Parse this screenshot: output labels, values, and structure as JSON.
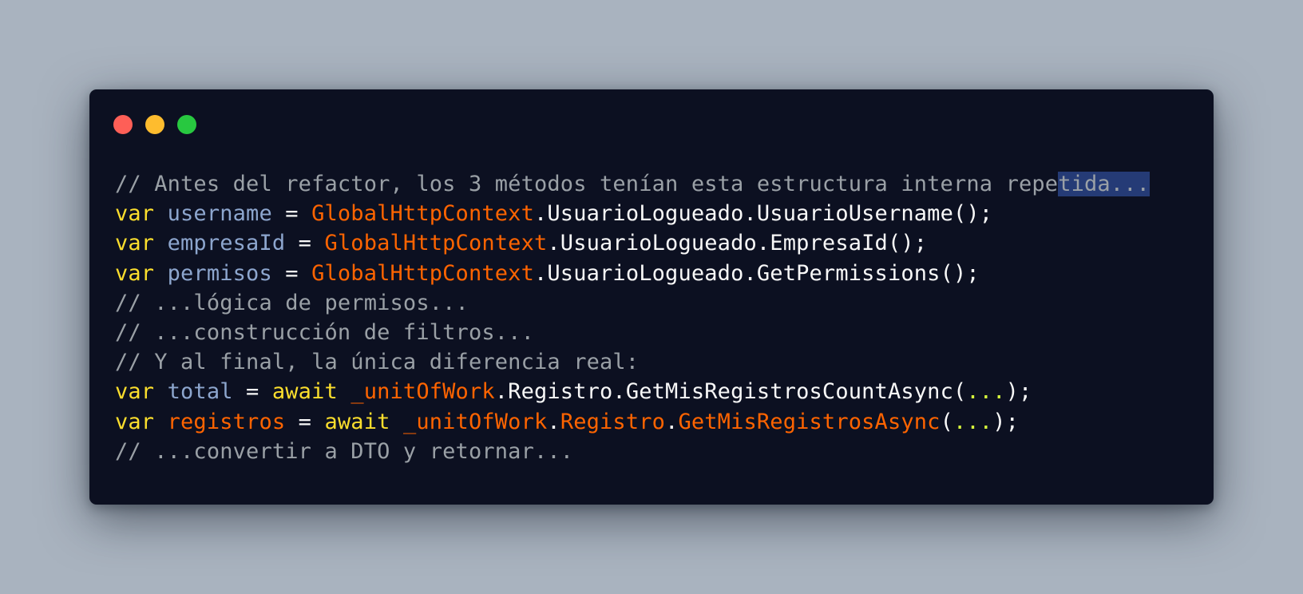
{
  "window": {
    "buttons": {
      "close": "close",
      "minimize": "minimize",
      "maximize": "maximize"
    },
    "colors": {
      "background": "#0c1021",
      "comment": "#9aa0a6",
      "keyword": "#fbde2d",
      "variable": "#8da6ce",
      "class": "#ff6400",
      "identifier": "#f8f8f8",
      "ellipsis": "#d8fa3c",
      "selection": "#253b76"
    }
  },
  "code": {
    "lines": [
      {
        "comment_before_selection": "// Antes del refactor, los 3 métodos tenían esta estructura interna repe",
        "comment_selected": "tida..."
      },
      {
        "kw": "var",
        "var": "username",
        "eq": " = ",
        "cls": "GlobalHttpContext",
        "rest": ".UsuarioLogueado.UsuarioUsername();"
      },
      {
        "kw": "var",
        "var": "empresaId",
        "eq": " = ",
        "cls": "GlobalHttpContext",
        "rest": ".UsuarioLogueado.EmpresaId();"
      },
      {
        "kw": "var",
        "var": "permisos",
        "eq": " = ",
        "cls": "GlobalHttpContext",
        "rest": ".UsuarioLogueado.GetPermissions();"
      },
      {
        "comment": "// ...lógica de permisos..."
      },
      {
        "comment": "// ...construcción de filtros..."
      },
      {
        "comment": "// Y al final, la única diferencia real:"
      },
      {
        "kw": "var",
        "var": "total",
        "eq": " = ",
        "kw2": "await",
        "cls": "_unitOfWork",
        "rest": ".Registro.GetMisRegistrosCountAsync(",
        "dots": "...",
        "end": ");"
      },
      {
        "kw": "var",
        "var": "registros",
        "eq": " = ",
        "kw2": "await",
        "cls": "_unitOfWork",
        "p1": ".",
        "cls2": "Registro",
        "p2": ".",
        "cls3": "GetMisRegistrosAsync",
        "p3": "(",
        "dots": "...",
        "end": ");"
      },
      {
        "comment": "// ...convertir a DTO y retornar..."
      }
    ]
  }
}
